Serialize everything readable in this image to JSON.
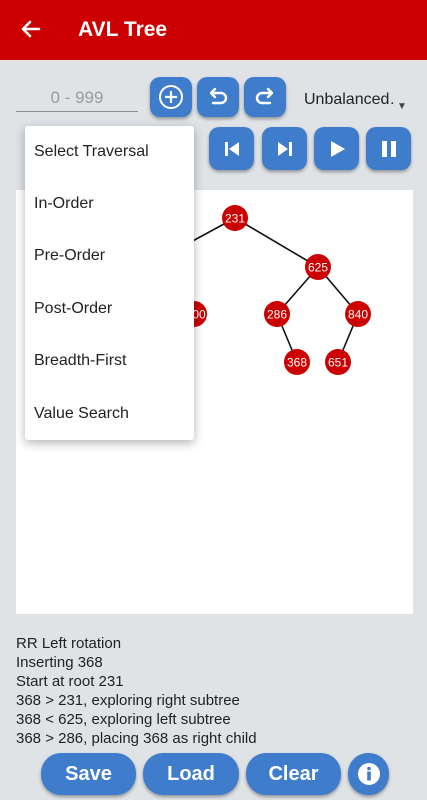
{
  "appbar": {
    "title": "AVL Tree",
    "back_icon": "arrow-left-icon",
    "color": "#cc0000"
  },
  "controls": {
    "input_placeholder": "0 - 999",
    "tree_type": "Unbalanced",
    "tree_type_display": "Unbalanced…",
    "accent": "#3f7dcc"
  },
  "traversal_menu": {
    "items": [
      "Select Traversal",
      "In-Order",
      "Pre-Order",
      "Post-Order",
      "Breadth-First",
      "Value Search"
    ]
  },
  "tree": {
    "node_color": "#cc0000",
    "nodes": [
      {
        "id": "n231",
        "label": "231"
      },
      {
        "id": "n625",
        "label": "625"
      },
      {
        "id": "n286",
        "label": "286"
      },
      {
        "id": "n840",
        "label": "840"
      },
      {
        "id": "n368",
        "label": "368"
      },
      {
        "id": "n651",
        "label": "651"
      },
      {
        "id": "nleft",
        "label": "00"
      }
    ]
  },
  "log": {
    "lines": [
      "RR Left rotation",
      "Inserting 368",
      "Start at root 231",
      "368 > 231, exploring right subtree",
      "368 < 625, exploring left subtree",
      "368 > 286, placing 368 as right child"
    ]
  },
  "bottom": {
    "save": "Save",
    "load": "Load",
    "clear": "Clear",
    "info_icon": "info-icon"
  }
}
